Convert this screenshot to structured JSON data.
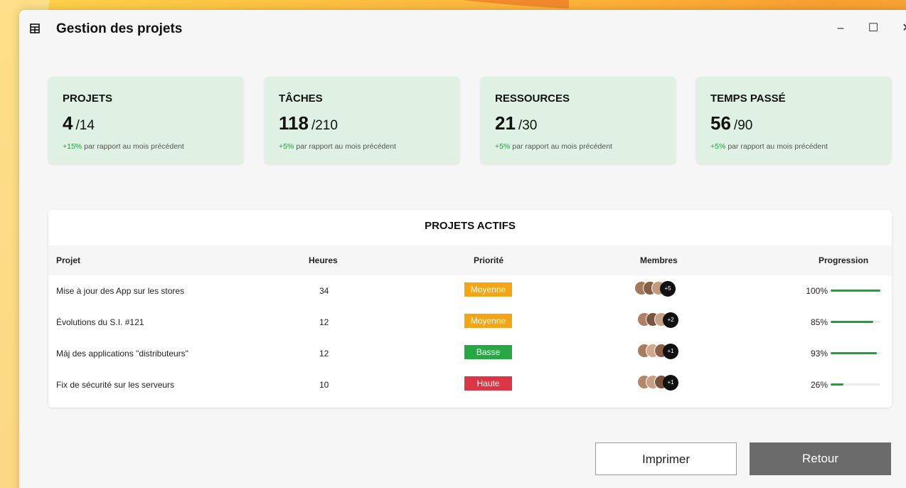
{
  "window": {
    "title": "Gestion des projets",
    "controls": {
      "minimize": "–",
      "maximize": "☐",
      "close": "✕"
    }
  },
  "stats": [
    {
      "title": "PROJETS",
      "value": "4",
      "total": "/14",
      "change": "+15%",
      "note": "par rapport au mois précédent"
    },
    {
      "title": "TÂCHES",
      "value": "118",
      "total": "/210",
      "change": "+5%",
      "note": "par rapport au mois précédent"
    },
    {
      "title": "RESSOURCES",
      "value": "21",
      "total": "/30",
      "change": "+5%",
      "note": "par rapport au mois précédent"
    },
    {
      "title": "TEMPS PASSÉ",
      "value": "56",
      "total": "/90",
      "change": "+5%",
      "note": "par rapport au mois précédent"
    }
  ],
  "panel": {
    "title": "PROJETS ACTIFS",
    "columns": {
      "project": "Projet",
      "hours": "Heures",
      "priority": "Priorité",
      "members": "Membres",
      "progress": "Progression"
    },
    "rows": [
      {
        "project": "Mise à jour des App sur les stores",
        "hours": "34",
        "priority": "Moyenne",
        "members_more": "+5",
        "progress_label": "100%",
        "progress": 1.0
      },
      {
        "project": "Évolutions du S.I. #121",
        "hours": "12",
        "priority": "Moyenne",
        "members_more": "+2",
        "progress_label": "85%",
        "progress": 0.85
      },
      {
        "project": "Màj des applications \"distributeurs\"",
        "hours": "12",
        "priority": "Basse",
        "members_more": "+1",
        "progress_label": "93%",
        "progress": 0.93
      },
      {
        "project": "Fix de sécurité sur les serveurs",
        "hours": "10",
        "priority": "Haute",
        "members_more": "+1",
        "progress_label": "26%",
        "progress": 0.26
      }
    ]
  },
  "priority_colors": {
    "Moyenne": "#f5a414",
    "Basse": "#27a844",
    "Haute": "#dc3545"
  },
  "accent_green": "#1aa336",
  "buttons": {
    "print": "Imprimer",
    "back": "Retour"
  }
}
